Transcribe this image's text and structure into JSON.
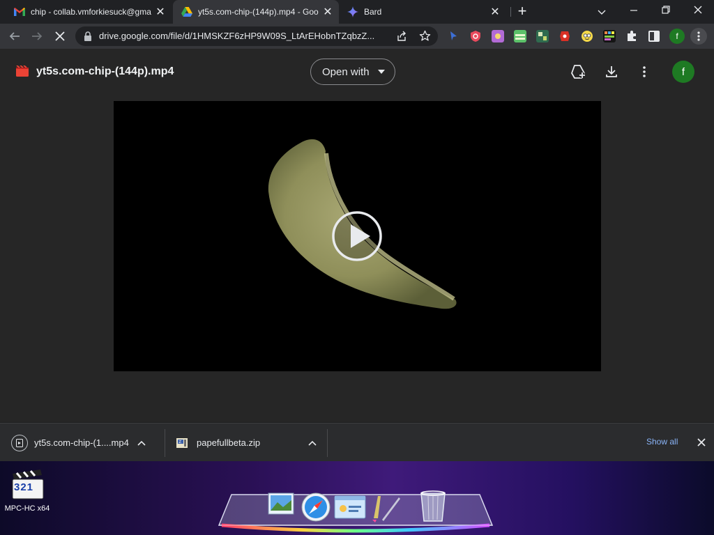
{
  "tabs": [
    {
      "title": "chip - collab.vmforkiesuck@gma",
      "icon": "gmail-icon",
      "active": false
    },
    {
      "title": "yt5s.com-chip-(144p).mp4 - Goo",
      "icon": "google-drive-icon",
      "active": true
    },
    {
      "title": "Bard",
      "icon": "bard-icon",
      "active": false
    }
  ],
  "new_tab_symbol": "+",
  "toolbar": {
    "url": "drive.google.com/file/d/1HMSKZF6zHP9W09S_LtArEHobnTZqbzZ...",
    "profile_initial": "f"
  },
  "viewer": {
    "file_title": "yt5s.com-chip-(144p).mp4",
    "open_with_label": "Open with",
    "avatar_initial": "f"
  },
  "downloads": {
    "items": [
      {
        "name": "yt5s.com-chip-(1....mp4",
        "icon": "video-file-icon"
      },
      {
        "name": "papefullbeta.zip",
        "icon": "zip-file-icon"
      }
    ],
    "show_all_label": "Show all"
  },
  "desktop": {
    "icon_label": "MPC-HC x64",
    "icon_badge": "321"
  },
  "colors": {
    "tabstrip": "#202124",
    "toolbar": "#35363a",
    "viewer_bg": "#262626",
    "avatar_green": "#1e7a23",
    "drive_red": "#ea4335"
  }
}
